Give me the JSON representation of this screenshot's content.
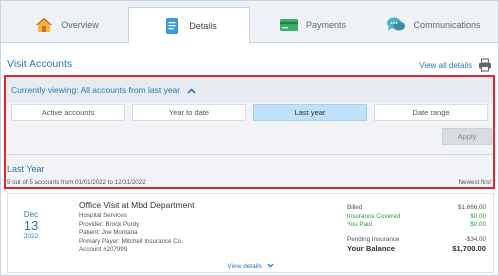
{
  "colors": {
    "accent": "#2a79b5",
    "highlight": "#e0262e",
    "active_filter": "#bfe1fb",
    "green": "#2b9a3d"
  },
  "tabs": [
    {
      "label": "Overview",
      "icon": "home-icon"
    },
    {
      "label": "Details",
      "icon": "document-icon",
      "selected": true
    },
    {
      "label": "Payments",
      "icon": "credit-card-icon"
    },
    {
      "label": "Communications",
      "icon": "chat-bubbles-icon"
    }
  ],
  "header": {
    "title": "Visit Accounts",
    "view_all": "View all details",
    "print_icon": "printer-icon"
  },
  "filter": {
    "viewing": "Currently viewing: All accounts from last year",
    "options": [
      "Active accounts",
      "Year to date",
      "Last year",
      "Date range"
    ],
    "selected": "Last year",
    "apply": "Apply"
  },
  "summary": {
    "title": "Last Year",
    "range": "5 out of 5 accounts from 01/01/2022 to 12/31/2022",
    "sort": "Newest first"
  },
  "visit": {
    "month": "Dec",
    "day": "13",
    "year": "2022",
    "name": "Office Visit at Mbd Department",
    "service": "Hospital Services",
    "provider": "Provider: Brock Purdy",
    "patient": "Patient: Joe Montana",
    "payer": "Primary Payer: Mitchell Insurance Co.",
    "account": "Account #207999",
    "billed_label": "Billed",
    "billed": "$1,666.00",
    "ins_label": "Insurance Covered",
    "ins": "$0.00",
    "paid_label": "You Paid",
    "paid": "$0.00",
    "pending_label": "Pending Insurance",
    "pending": "-$34.00",
    "balance_label": "Your Balance",
    "balance": "$1,700.00",
    "view_details": "View details"
  }
}
